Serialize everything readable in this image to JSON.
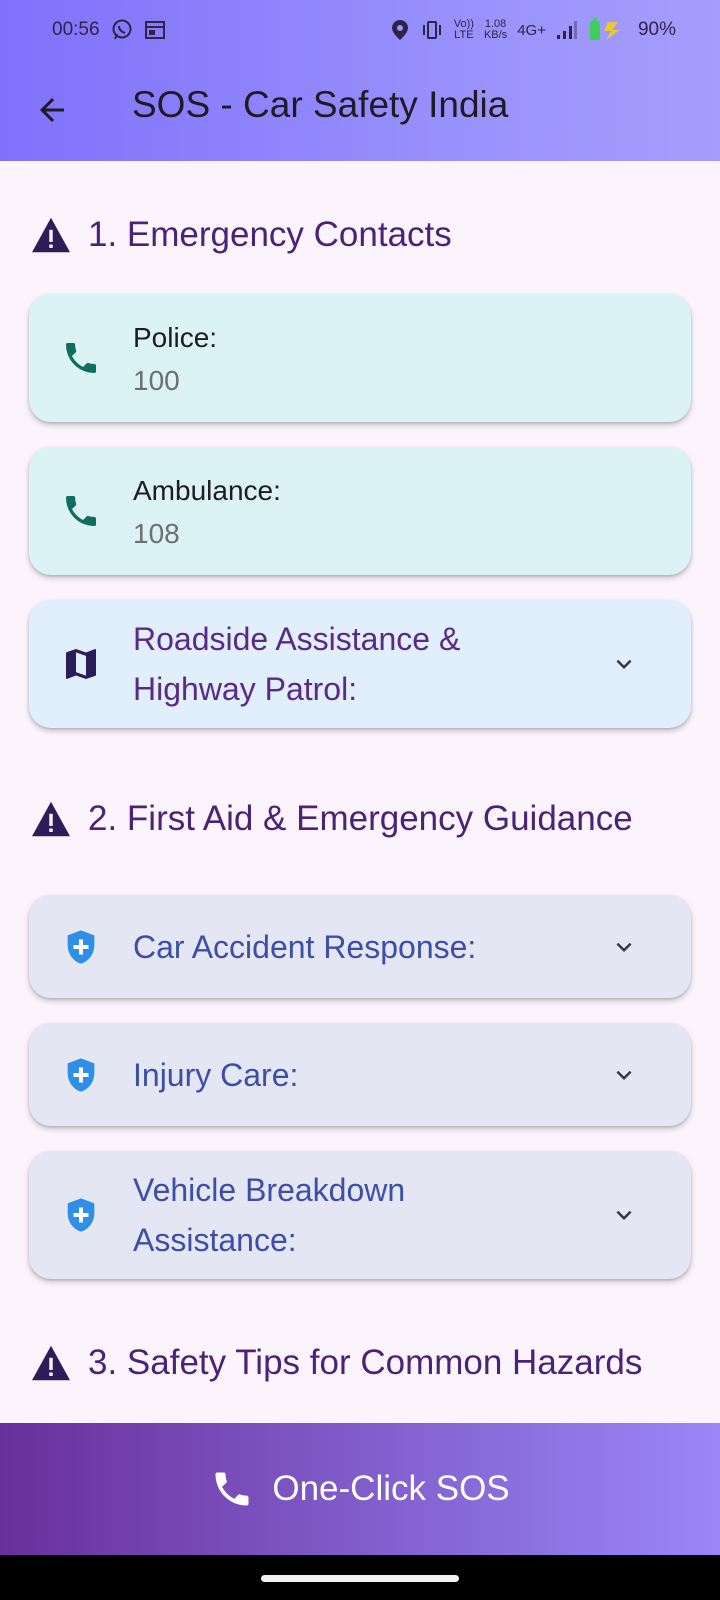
{
  "status_bar": {
    "time": "00:56",
    "net_speed_top": "1.08",
    "net_speed_bottom": "KB/s",
    "volte_top": "Vo))",
    "volte_bottom": "LTE",
    "network": "4G+",
    "battery": "90%"
  },
  "app_bar": {
    "title": "SOS - Car Safety India"
  },
  "sections": [
    {
      "heading": "1. Emergency Contacts"
    },
    {
      "heading": "2. First Aid & Emergency Guidance"
    },
    {
      "heading": "3. Safety Tips for Common Hazards"
    }
  ],
  "contacts": [
    {
      "label": "Police:",
      "number": "100"
    },
    {
      "label": "Ambulance:",
      "number": "108"
    }
  ],
  "roadside": {
    "line1": "Roadside Assistance &",
    "line2": "Highway Patrol:"
  },
  "first_aid": [
    {
      "line1": "Car Accident Response:",
      "line2": ""
    },
    {
      "line1": "Injury Care:",
      "line2": ""
    },
    {
      "line1": "Vehicle Breakdown",
      "line2": "Assistance:"
    }
  ],
  "sos_button": {
    "label": "One-Click SOS"
  },
  "colors": {
    "section_heading": "#4b2277",
    "contact_card": "#dcf3f6",
    "roadside_card": "#e1eefb",
    "aid_card": "#e5e6f3",
    "phone_icon": "#0f6e5c",
    "shield_icon": "#2f8fe6",
    "aid_text": "#3d4ea6"
  },
  "icons": [
    "arrow-back-icon",
    "warning-icon",
    "phone-icon",
    "map-icon",
    "shield-plus-icon",
    "chevron-down-icon"
  ]
}
